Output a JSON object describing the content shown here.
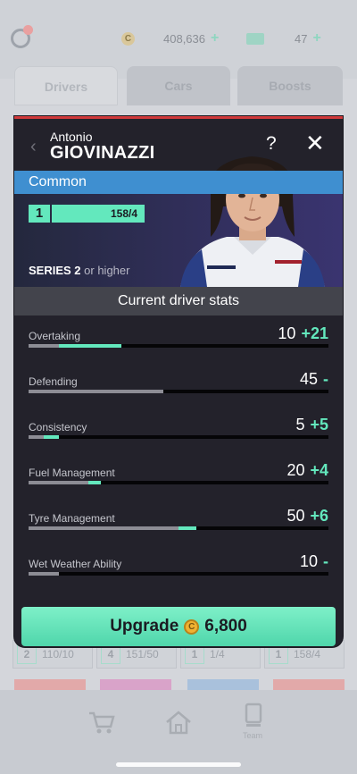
{
  "topbar": {
    "coins": "408,636",
    "tickets": "47",
    "plus": "+"
  },
  "tabs": [
    {
      "label": "Drivers"
    },
    {
      "label": "Cars"
    },
    {
      "label": "Boosts"
    }
  ],
  "background_cards": [
    {
      "level": "2",
      "progress": "110/10"
    },
    {
      "level": "4",
      "progress": "151/50"
    },
    {
      "level": "1",
      "progress": "1/4"
    },
    {
      "level": "1",
      "progress": "158/4"
    }
  ],
  "bottom_nav": {
    "team_label": "Team"
  },
  "modal": {
    "first_name": "Antonio",
    "last_name": "GIOVINAZZI",
    "help_glyph": "?",
    "close_glyph": "✕",
    "back_glyph": "‹",
    "rarity": "Common",
    "level": "1",
    "cards": "158/4",
    "series_label": "SERIES 2",
    "series_suffix": "or higher",
    "stats_title": "Current driver stats",
    "stats": [
      {
        "name": "Overtaking",
        "value": "10",
        "delta": "+21",
        "base": 0.1,
        "boost": 0.21
      },
      {
        "name": "Defending",
        "value": "45",
        "delta": "-",
        "base": 0.45,
        "boost": 0
      },
      {
        "name": "Consistency",
        "value": "5",
        "delta": "+5",
        "base": 0.05,
        "boost": 0.05
      },
      {
        "name": "Fuel Management",
        "value": "20",
        "delta": "+4",
        "base": 0.2,
        "boost": 0.04
      },
      {
        "name": "Tyre Management",
        "value": "50",
        "delta": "+6",
        "base": 0.5,
        "boost": 0.06
      },
      {
        "name": "Wet Weather Ability",
        "value": "10",
        "delta": "-",
        "base": 0.1,
        "boost": 0
      }
    ],
    "upgrade_label": "Upgrade",
    "upgrade_cost": "6,800",
    "coin_glyph": "C"
  },
  "colors": {
    "accent": "#63e8bd",
    "rarity_blue": "#3f8fd0",
    "modal_bg": "#23222b",
    "header_red": "#d0393b"
  }
}
